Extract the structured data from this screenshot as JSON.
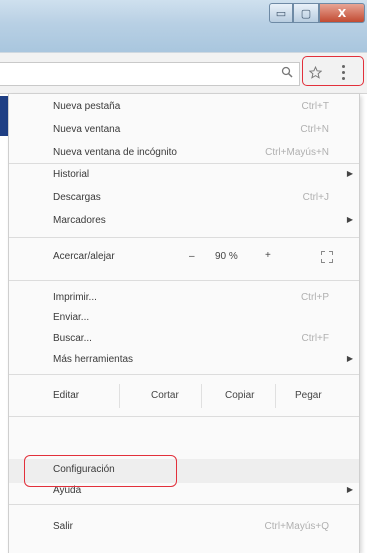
{
  "window": {
    "min_label": "▭",
    "max_label": "▢",
    "close_label": "X"
  },
  "toolbar": {
    "zoom_icon": "magnifier-icon",
    "star_icon": "star-icon",
    "menu_icon": "three-dot-menu-icon"
  },
  "menu": {
    "items": [
      {
        "label": "Nueva pestaña",
        "shortcut": "Ctrl+T"
      },
      {
        "label": "Nueva ventana",
        "shortcut": "Ctrl+N"
      },
      {
        "label": "Nueva ventana de incógnito",
        "shortcut": "Ctrl+Mayús+N"
      },
      {
        "label": "Historial",
        "shortcut": ""
      },
      {
        "label": "Descargas",
        "shortcut": "Ctrl+J"
      },
      {
        "label": "Marcadores",
        "shortcut": ""
      },
      {
        "label": "Imprimir...",
        "shortcut": "Ctrl+P"
      },
      {
        "label": "Enviar...",
        "shortcut": ""
      },
      {
        "label": "Buscar...",
        "shortcut": "Ctrl+F"
      },
      {
        "label": "Más herramientas",
        "shortcut": ""
      },
      {
        "label": "Configuración",
        "shortcut": ""
      },
      {
        "label": "Ayuda",
        "shortcut": ""
      },
      {
        "label": "Salir",
        "shortcut": "Ctrl+Mayús+Q"
      }
    ],
    "zoom": {
      "label": "Acercar/alejar",
      "minus": "–",
      "value": "90 %",
      "plus": "+"
    },
    "edit": {
      "label": "Editar",
      "cut": "Cortar",
      "copy": "Copiar",
      "paste": "Pegar"
    }
  }
}
